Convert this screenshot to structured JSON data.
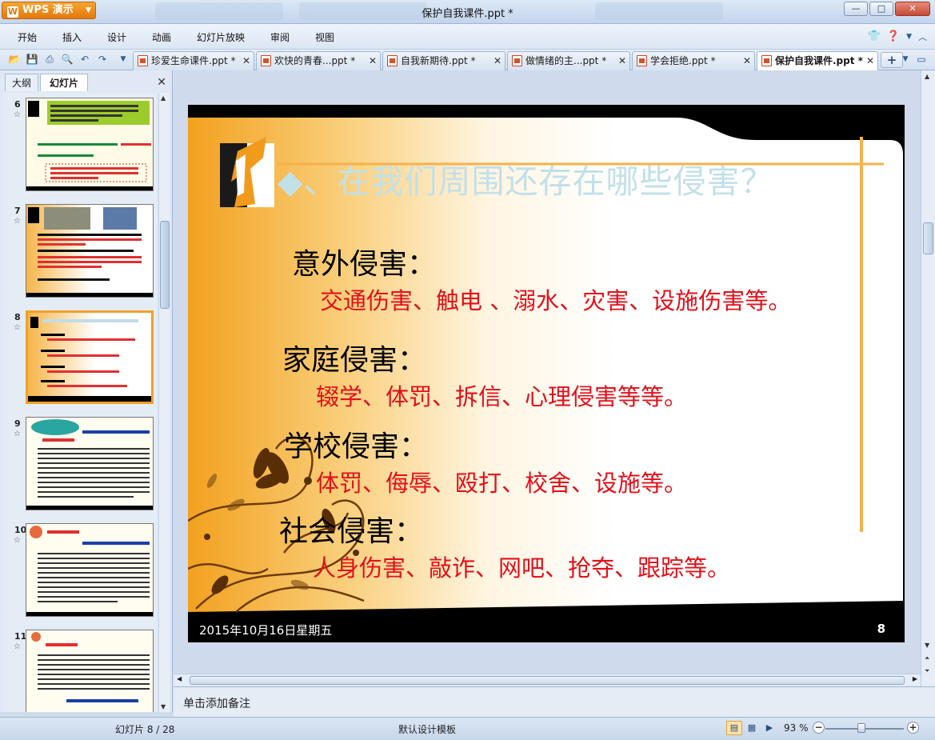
{
  "app": {
    "button_label": "WPS 演示",
    "window_title": "保护自我课件.ppt *",
    "window_controls": {
      "minimize": "—",
      "maximize": "□",
      "close": "✕"
    }
  },
  "menu": {
    "items": [
      "开始",
      "插入",
      "设计",
      "动画",
      "幻灯片放映",
      "审阅",
      "视图"
    ]
  },
  "doc_tabs": [
    {
      "label": "珍爱生命课件.ppt *",
      "active": false
    },
    {
      "label": "欢快的青春...ppt *",
      "active": false
    },
    {
      "label": "自我新期待.ppt *",
      "active": false
    },
    {
      "label": "做情绪的主...ppt *",
      "active": false
    },
    {
      "label": "学会拒绝.ppt *",
      "active": false
    },
    {
      "label": "保护自我课件.ppt *",
      "active": true
    }
  ],
  "panel": {
    "tabs": [
      "大纲",
      "幻灯片"
    ],
    "active_tab": "幻灯片",
    "thumbnails": [
      {
        "number": "6"
      },
      {
        "number": "7"
      },
      {
        "number": "8",
        "selected": true
      },
      {
        "number": "9"
      },
      {
        "number": "10"
      },
      {
        "number": "11"
      }
    ]
  },
  "slide": {
    "title": "◆、在我们周围还存在哪些侵害？",
    "categories": [
      {
        "heading": "意外侵害：",
        "detail": "交通伤害、触电 、溺水、灾害、设施伤害等。"
      },
      {
        "heading": "家庭侵害：",
        "detail": "辍学、体罚、拆信、心理侵害等等。"
      },
      {
        "heading": "学校侵害：",
        "detail": "体罚、侮辱、殴打、校舍、设施等。"
      },
      {
        "heading": "社会侵害：",
        "detail": "人身伤害、敲诈、网吧、抢夺、跟踪等。"
      }
    ],
    "footer_date": "2015年10月16日星期五",
    "page_number": "8"
  },
  "notes_placeholder": "单击添加备注",
  "status": {
    "slide_position": "幻灯片 8 / 28",
    "template": "默认设计模板",
    "zoom": "93 %"
  },
  "colors": {
    "accent_orange": "#f29f2c",
    "title_color": "#c2e0e8",
    "detail_red": "#e2101a"
  }
}
